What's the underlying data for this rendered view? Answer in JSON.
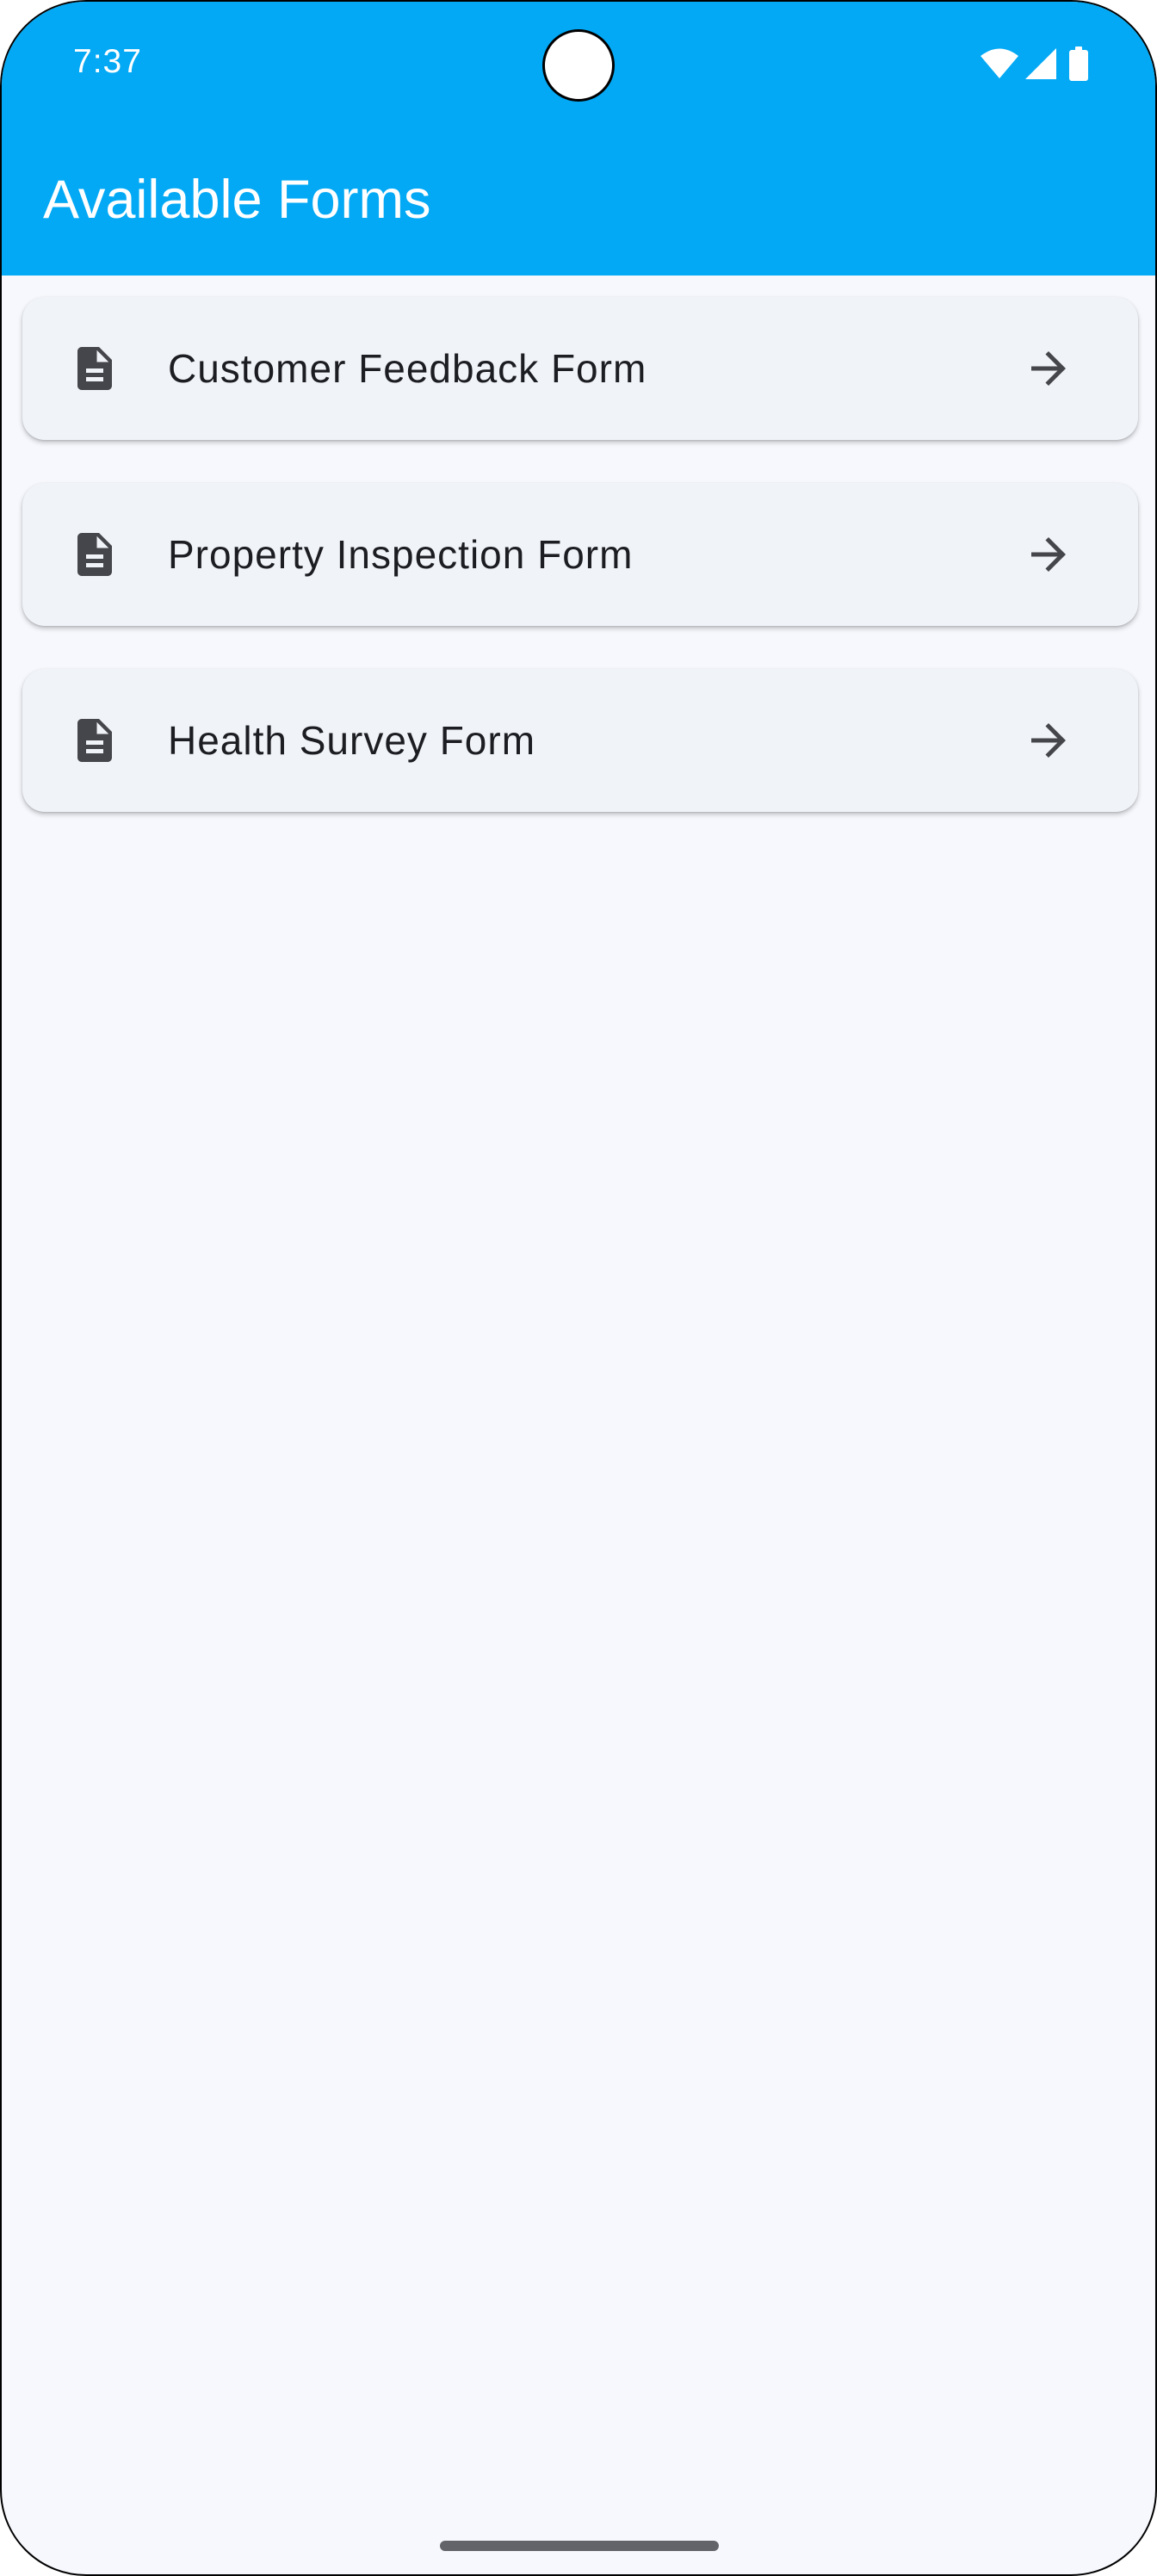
{
  "status_bar": {
    "time": "7:37",
    "icons": [
      "wifi-icon",
      "cellular-signal-icon",
      "battery-icon"
    ]
  },
  "app_bar": {
    "title": "Available Forms",
    "background_color": "#03a9f4"
  },
  "forms": [
    {
      "label": "Customer Feedback Form",
      "leading_icon": "document-icon",
      "trailing_icon": "arrow-forward-icon"
    },
    {
      "label": "Property Inspection Form",
      "leading_icon": "document-icon",
      "trailing_icon": "arrow-forward-icon"
    },
    {
      "label": "Health Survey Form",
      "leading_icon": "document-icon",
      "trailing_icon": "arrow-forward-icon"
    }
  ],
  "colors": {
    "page_background": "#f6f8fd",
    "card_background": "#f0f3f8",
    "text": "#1c1d22",
    "icon": "#45464c"
  }
}
